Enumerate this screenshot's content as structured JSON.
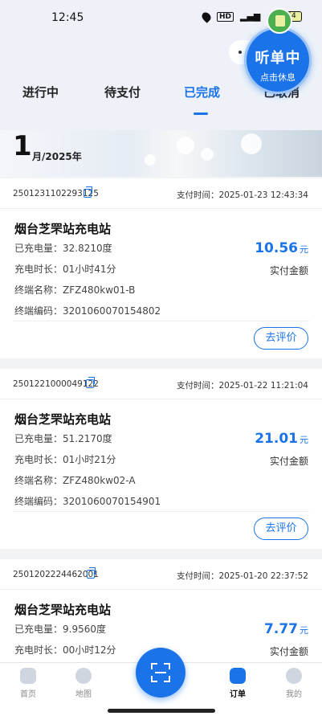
{
  "status_bar": {
    "time": "12:45",
    "hd": "HD",
    "battery": "54"
  },
  "tabs": [
    {
      "label": "进行中"
    },
    {
      "label": "待支付"
    },
    {
      "label": "已完成"
    },
    {
      "label": "已取消"
    }
  ],
  "active_tab": "已完成",
  "listen_button": {
    "main": "听单中",
    "sub": "点击休息"
  },
  "month_banner": {
    "month": "1",
    "text": "月/2025年"
  },
  "orders": [
    {
      "order_no": "2501231102293125",
      "pay_time": "支付时间：2025-01-23 12:43:34",
      "station": "烟台芝罘站充电站",
      "charged": "已充电量：32.8210度",
      "duration": "充电时长：01小时41分",
      "terminal_name": "终端名称：ZFZ480kw01-B",
      "terminal_code": "终端编码：3201060070154802",
      "amount": "10.56",
      "unit": "元",
      "amount_label": "实付金额",
      "review": "去评价"
    },
    {
      "order_no": "2501221000049122",
      "pay_time": "支付时间：2025-01-22 11:21:04",
      "station": "烟台芝罘站充电站",
      "charged": "已充电量：51.2170度",
      "duration": "充电时长：01小时21分",
      "terminal_name": "终端名称：ZFZ480kw02-A",
      "terminal_code": "终端编码：3201060070154901",
      "amount": "21.01",
      "unit": "元",
      "amount_label": "实付金额",
      "review": "去评价"
    },
    {
      "order_no": "2501202224462001",
      "pay_time": "支付时间：2025-01-20 22:37:52",
      "station": "烟台芝罘站充电站",
      "charged": "已充电量：9.9560度",
      "duration": "充电时长：00小时12分",
      "amount": "7.77",
      "unit": "元",
      "amount_label": "实付金额"
    }
  ],
  "bottom_nav": [
    {
      "label": "首页",
      "icon": "home-icon"
    },
    {
      "label": "地图",
      "icon": "map-icon"
    },
    {
      "label": "订单",
      "icon": "order-icon"
    },
    {
      "label": "我的",
      "icon": "profile-icon"
    }
  ],
  "colors": {
    "accent": "#1a73e8",
    "background": "#f2f3f5"
  }
}
